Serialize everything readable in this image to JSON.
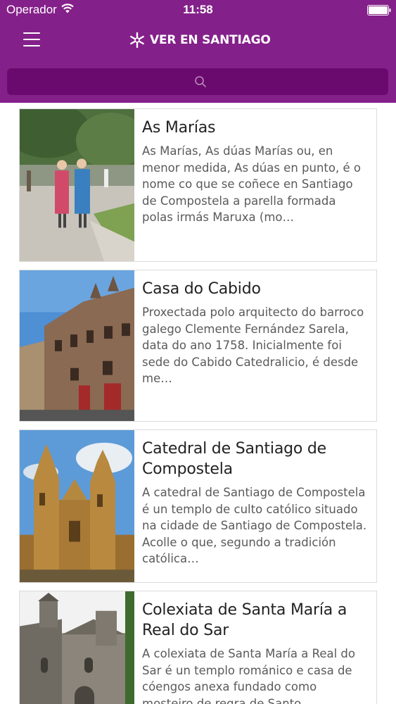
{
  "status_bar": {
    "carrier": "Operador",
    "time": "11:58"
  },
  "header": {
    "title": "VER EN SANTIAGO",
    "logo_icon": "asterisk-star-icon",
    "menu_icon": "hamburger-menu-icon",
    "background_color": "#84208a"
  },
  "search": {
    "placeholder": "",
    "value": "",
    "icon": "search-icon",
    "background_color": "#6b0a6e"
  },
  "places": [
    {
      "title": "As Marías",
      "description": "As Marías, As dúas Marías ou, en menor medida, As dúas en punto, é o nome co que se coñece en Santiago de Compostela a parella formada polas irmás Maruxa (mo…",
      "image": "photo-as-marias-statues"
    },
    {
      "title": "Casa do Cabido",
      "description": "Proxectada polo arquitecto do barroco galego Clemente Fernández Sarela, data do ano 1758. Inicialmente foi sede do Cabido Catedralicio, é desde me…",
      "image": "photo-casa-do-cabido-facade"
    },
    {
      "title": "Catedral de Santiago de Compostela",
      "description": "A catedral de Santiago de Compostela é un templo de culto católico situado na cidade de Santiago de Compostela. Acolle o que, segundo a tradición católica…",
      "image": "photo-cathedral-towers"
    },
    {
      "title": "Colexiata de Santa María a Real do Sar",
      "description": "A colexiata de Santa María a Real do Sar é un templo románico e casa de cóengos anexa fundado como mosteiro de regra de Santo…",
      "image": "photo-colexiata-sar"
    }
  ]
}
